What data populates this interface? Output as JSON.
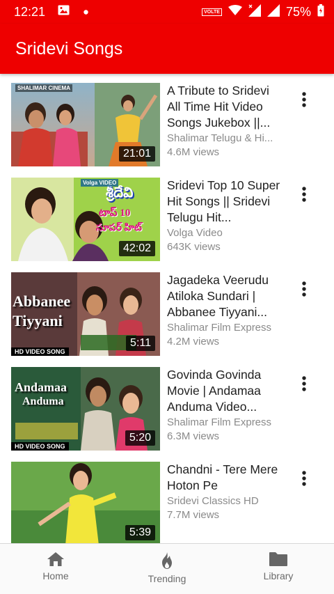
{
  "status_bar": {
    "time": "12:21",
    "volte": "VOLTE",
    "battery": "75%",
    "icons": [
      "image-icon",
      "dot-icon",
      "volte-icon",
      "wifi-icon",
      "signal-icon",
      "signal-icon",
      "battery-icon"
    ]
  },
  "app_bar": {
    "title": "Sridevi Songs",
    "color": "#ee0000"
  },
  "videos": [
    {
      "title": "A Tribute to Sridevi All Time Hit Video Songs Jukebox ||...",
      "channel": "Shalimar Telugu & Hi...",
      "views": "4.6M views",
      "duration": "21:01",
      "thumb_brand": "SHALIMAR CINEMA"
    },
    {
      "title": "Sridevi Top 10 Super Hit Songs || Sridevi Telugu Hit...",
      "channel": "Volga Video",
      "views": "643K views",
      "duration": "42:02",
      "thumb_brand": "Volga VIDEO",
      "thumb_line1": "శ్రీదేవి",
      "thumb_line2": "టాప్ 10",
      "thumb_line3": "సూపర్ హిట్"
    },
    {
      "title": "Jagadeka Veerudu Atiloka Sundari | Abbanee Tiyyani...",
      "channel": "Shalimar Film Express",
      "views": "4.2M views",
      "duration": "5:11",
      "thumb_line1": "Abbanee",
      "thumb_line2": "Tiyyani",
      "thumb_tag": "VIDEO SONG",
      "thumb_hd": "HD"
    },
    {
      "title": "Govinda Govinda Movie | Andamaa Anduma Video...",
      "channel": "Shalimar Film Express",
      "views": "6.3M views",
      "duration": "5:20",
      "thumb_line1": "Andamaa",
      "thumb_line2": "Anduma",
      "thumb_tag": "VIDEO SONG",
      "thumb_hd": "HD"
    },
    {
      "title": "Chandni - Tere Mere Hoton Pe",
      "channel": "Sridevi Classics HD",
      "views": "7.7M views",
      "duration": "5:39"
    }
  ],
  "bottom_nav": [
    {
      "label": "Home",
      "icon": "home-icon"
    },
    {
      "label": "Trending",
      "icon": "flame-icon"
    },
    {
      "label": "Library",
      "icon": "folder-icon"
    }
  ]
}
